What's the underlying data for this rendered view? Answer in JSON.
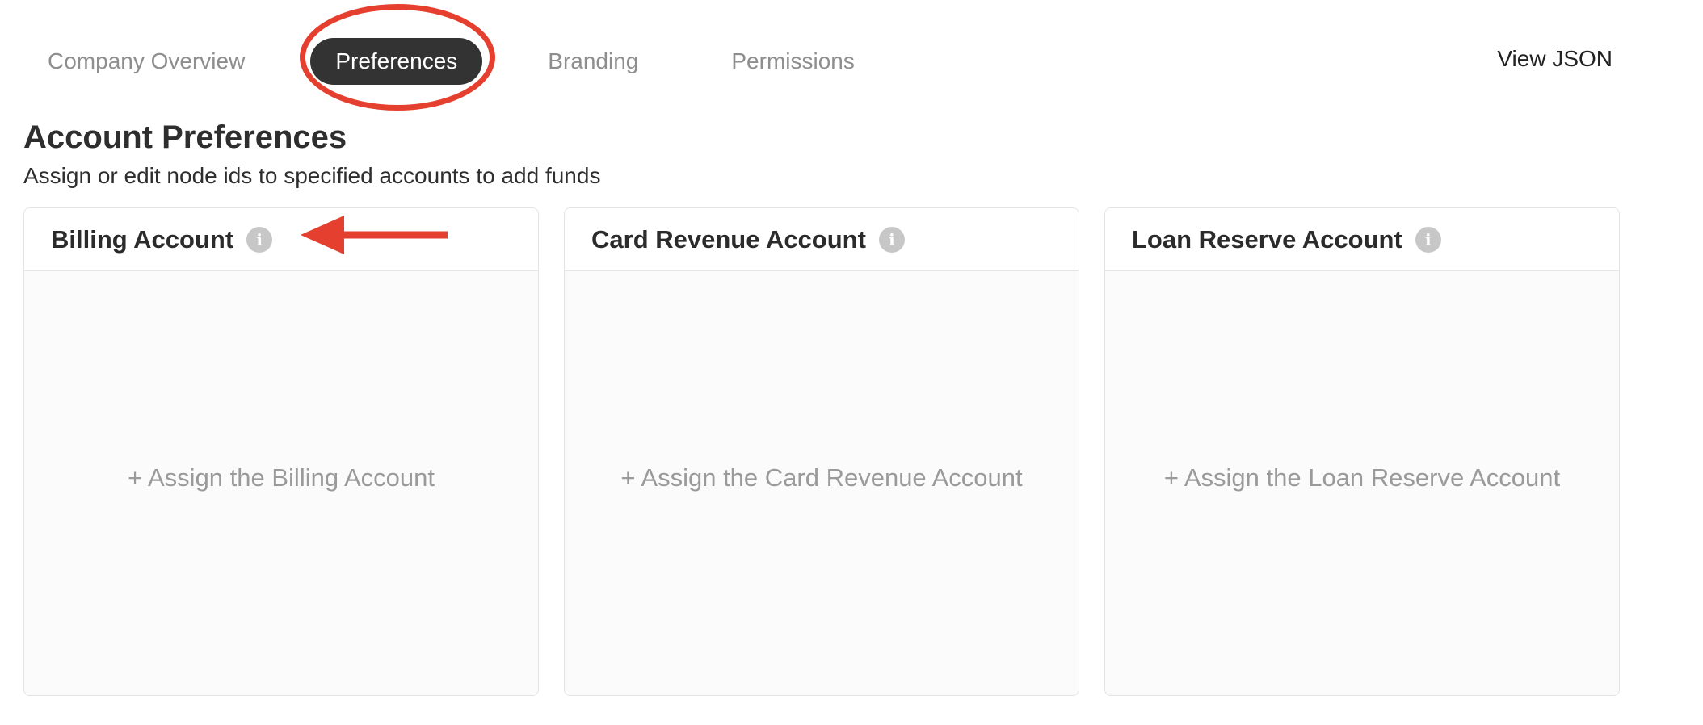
{
  "tabs": [
    {
      "label": "Company Overview"
    },
    {
      "label": "Preferences"
    },
    {
      "label": "Branding"
    },
    {
      "label": "Permissions"
    }
  ],
  "active_tab": "Preferences",
  "view_json_label": "View JSON",
  "heading": "Account Preferences",
  "subheading": "Assign or edit node ids to specified accounts to add funds",
  "cards": [
    {
      "title": "Billing Account",
      "info_icon": "info-icon",
      "assign_label": "+ Assign the Billing Account"
    },
    {
      "title": "Card Revenue Account",
      "info_icon": "info-icon",
      "assign_label": "+ Assign the Card Revenue Account"
    },
    {
      "title": "Loan Reserve Account",
      "info_icon": "info-icon",
      "assign_label": "+ Assign the Loan Reserve Account"
    }
  ],
  "colors": {
    "active_tab_bg": "#333333",
    "annotation": "#e5402f",
    "muted_text": "#9a9a9a"
  }
}
